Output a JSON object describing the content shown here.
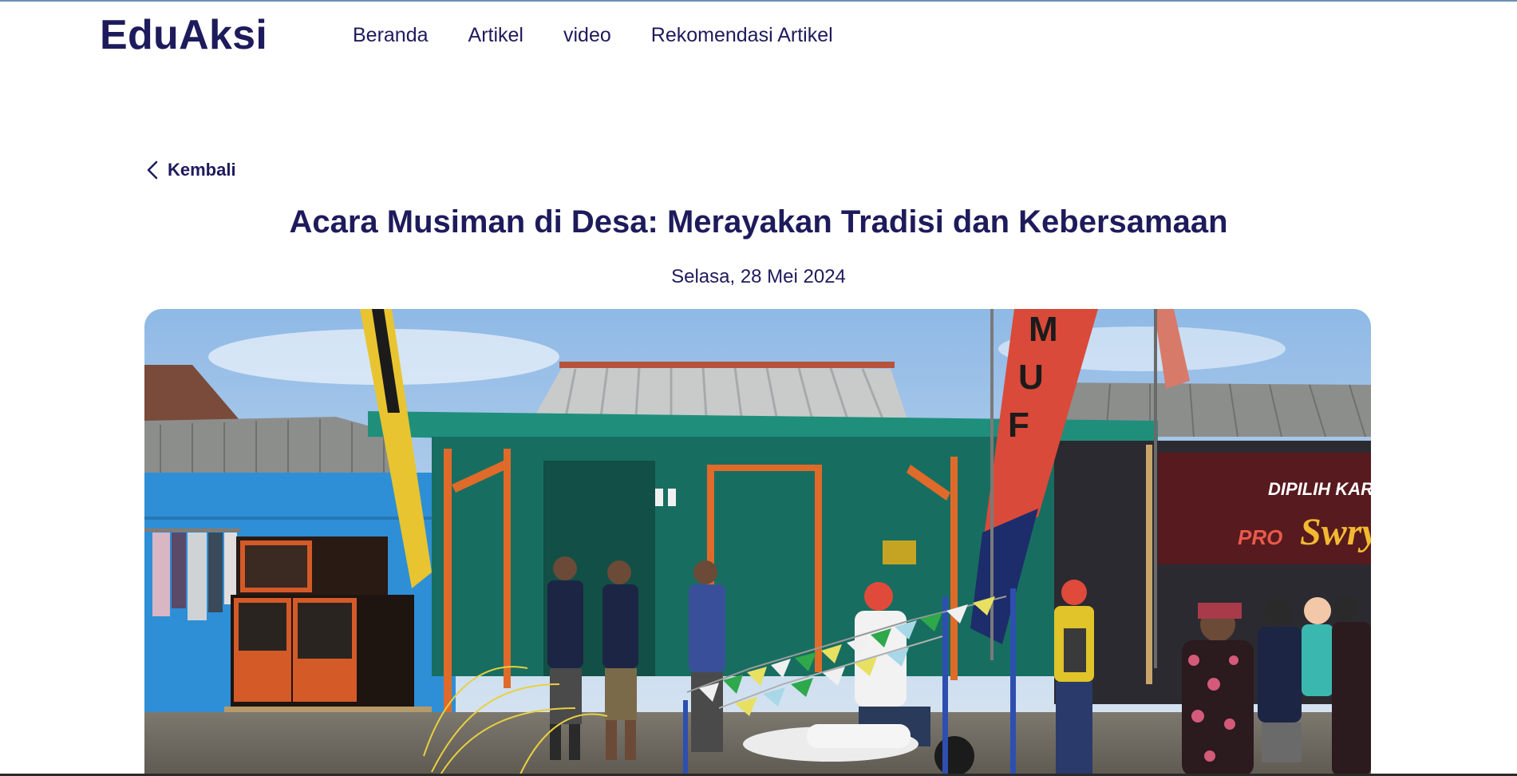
{
  "brand": {
    "name": "EduAksi"
  },
  "nav": {
    "items": [
      {
        "label": "Beranda"
      },
      {
        "label": "Artikel"
      },
      {
        "label": "video"
      },
      {
        "label": "Rekomendasi Artikel"
      }
    ]
  },
  "back": {
    "label": "Kembali",
    "icon": "chevron-left-icon"
  },
  "article": {
    "title": "Acara Musiman di Desa: Merayakan Tradisi dan Kebersamaan",
    "date": "Selasa, 28 Mei 2024"
  },
  "hero_image": {
    "banner_lines": [
      "DIPILIH KARENA",
      "PRO",
      "Swry"
    ],
    "flag_letters": [
      "M",
      "U",
      "F"
    ]
  },
  "colors": {
    "primary": "#1e1b5c",
    "teal_wall": "#1f8f7c",
    "blue_wall": "#2e8fd6",
    "flag_red": "#d94a3a",
    "flag_yellow": "#e8c430",
    "orange_trim": "#e06a2a"
  }
}
